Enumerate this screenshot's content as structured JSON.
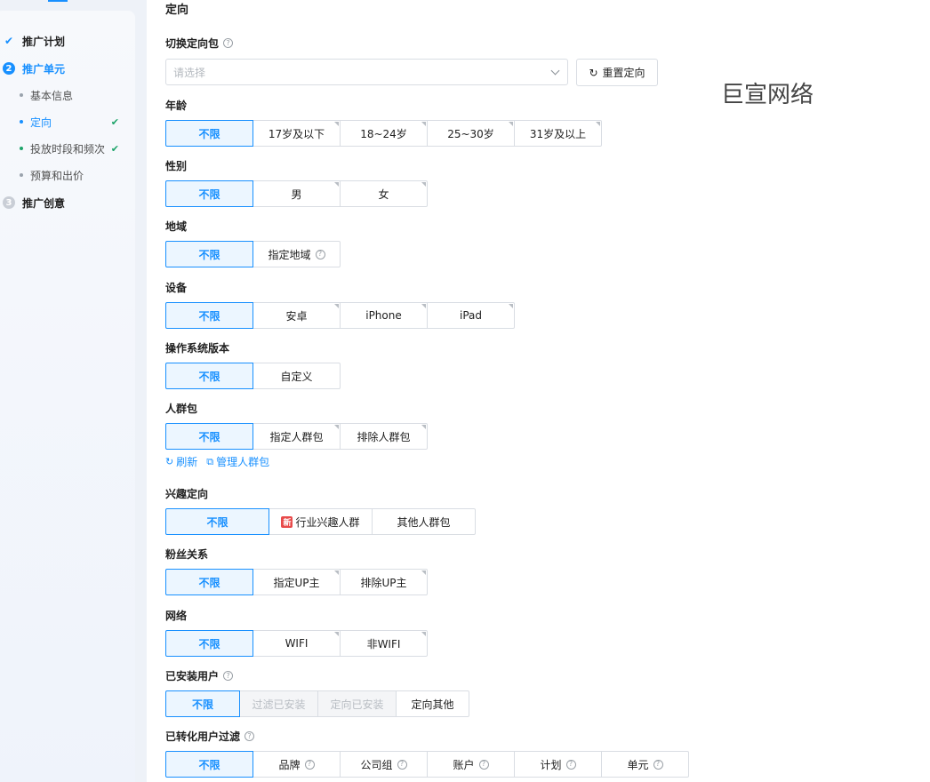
{
  "sidebar": {
    "steps": [
      {
        "label": "推广计划",
        "marker": "✔"
      },
      {
        "label": "推广单元",
        "marker": "2"
      },
      {
        "label": "推广创意",
        "marker": "3"
      }
    ],
    "substeps": [
      {
        "label": "基本信息",
        "ok": ""
      },
      {
        "label": "定向",
        "ok": "✔"
      },
      {
        "label": "投放时段和频次",
        "ok": "✔"
      },
      {
        "label": "预算和出价",
        "ok": ""
      }
    ]
  },
  "main": {
    "title": "定向",
    "package": {
      "label": "切换定向包",
      "placeholder": "请选择",
      "reset_label": "重置定向",
      "reset_icon": "refresh-icon"
    },
    "watermark": "巨宣网络",
    "age": {
      "label": "年龄",
      "options": [
        "不限",
        "17岁及以下",
        "18~24岁",
        "25~30岁",
        "31岁及以上"
      ]
    },
    "gender": {
      "label": "性别",
      "options": [
        "不限",
        "男",
        "女"
      ]
    },
    "region": {
      "label": "地域",
      "options": [
        "不限",
        "指定地域"
      ]
    },
    "device": {
      "label": "设备",
      "options": [
        "不限",
        "安卓",
        "iPhone",
        "iPad"
      ]
    },
    "os_version": {
      "label": "操作系统版本",
      "options": [
        "不限",
        "自定义"
      ]
    },
    "crowd": {
      "label": "人群包",
      "options": [
        "不限",
        "指定人群包",
        "排除人群包"
      ],
      "refresh_label": "刷新",
      "manage_label": "管理人群包"
    },
    "interest": {
      "label": "兴趣定向",
      "options": [
        "不限",
        "行业兴趣人群",
        "其他人群包"
      ],
      "new_tag": "新"
    },
    "fans": {
      "label": "粉丝关系",
      "options": [
        "不限",
        "指定UP主",
        "排除UP主"
      ]
    },
    "network": {
      "label": "网络",
      "options": [
        "不限",
        "WIFI",
        "非WIFI"
      ]
    },
    "installed": {
      "label": "已安装用户",
      "options": [
        "不限",
        "过滤已安装",
        "定向已安装",
        "定向其他"
      ]
    },
    "converted": {
      "label": "已转化用户过滤",
      "options": [
        "不限",
        "品牌",
        "公司组",
        "账户",
        "计划",
        "单元"
      ]
    }
  },
  "colors": {
    "accent": "#1890ff",
    "success": "#1ea46a"
  }
}
